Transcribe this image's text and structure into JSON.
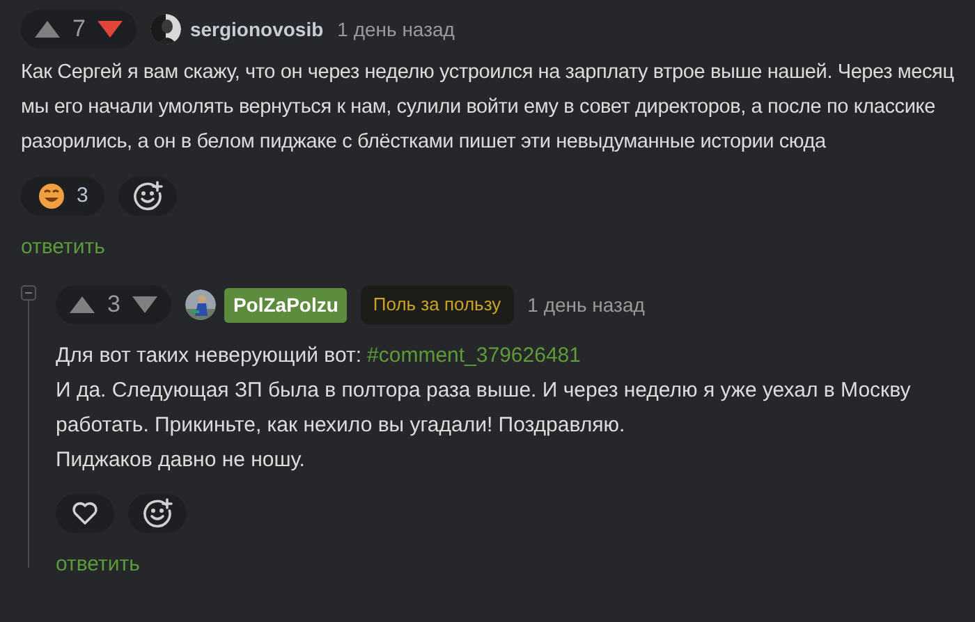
{
  "comments": [
    {
      "votes": {
        "count": "7",
        "up_selected": false,
        "down_selected": true
      },
      "author": {
        "name": "sergionovosib",
        "highlighted": false
      },
      "time": "1 день назад",
      "collapsible": false,
      "paragraphs": [
        {
          "text": "Как Сергей я вам скажу, что он через неделю устроился на зарплату втрое выше нашей. Через месяц мы его начали умолять вернуться к нам, сулили войти ему в совет директоров, а после по классике разорились, а он в белом пиджаке с блёстками пишет эти невыдуманные истории сюда"
        }
      ],
      "reactions": [
        {
          "kind": "emoji",
          "count": "3"
        },
        {
          "kind": "add"
        }
      ],
      "reply": "ответить"
    },
    {
      "votes": {
        "count": "3",
        "up_selected": false,
        "down_selected": false
      },
      "author": {
        "name": "PolZaPolzu",
        "highlighted": true,
        "badge": "Поль за пользу"
      },
      "time": "1 день назад",
      "collapsible": true,
      "paragraphs": [
        {
          "text": "Для вот таких неверующий вот:",
          "link": "#comment_379626481"
        },
        {
          "text": "И да. Следующая ЗП была в полтора раза выше. И через неделю я уже уехал в Москву работать. Прикиньте, как нехило вы угадали! Поздравляю."
        },
        {
          "text": "Пиджаков давно не ношу."
        }
      ],
      "reactions": [
        {
          "kind": "like"
        },
        {
          "kind": "add"
        }
      ],
      "reply": "ответить"
    }
  ]
}
